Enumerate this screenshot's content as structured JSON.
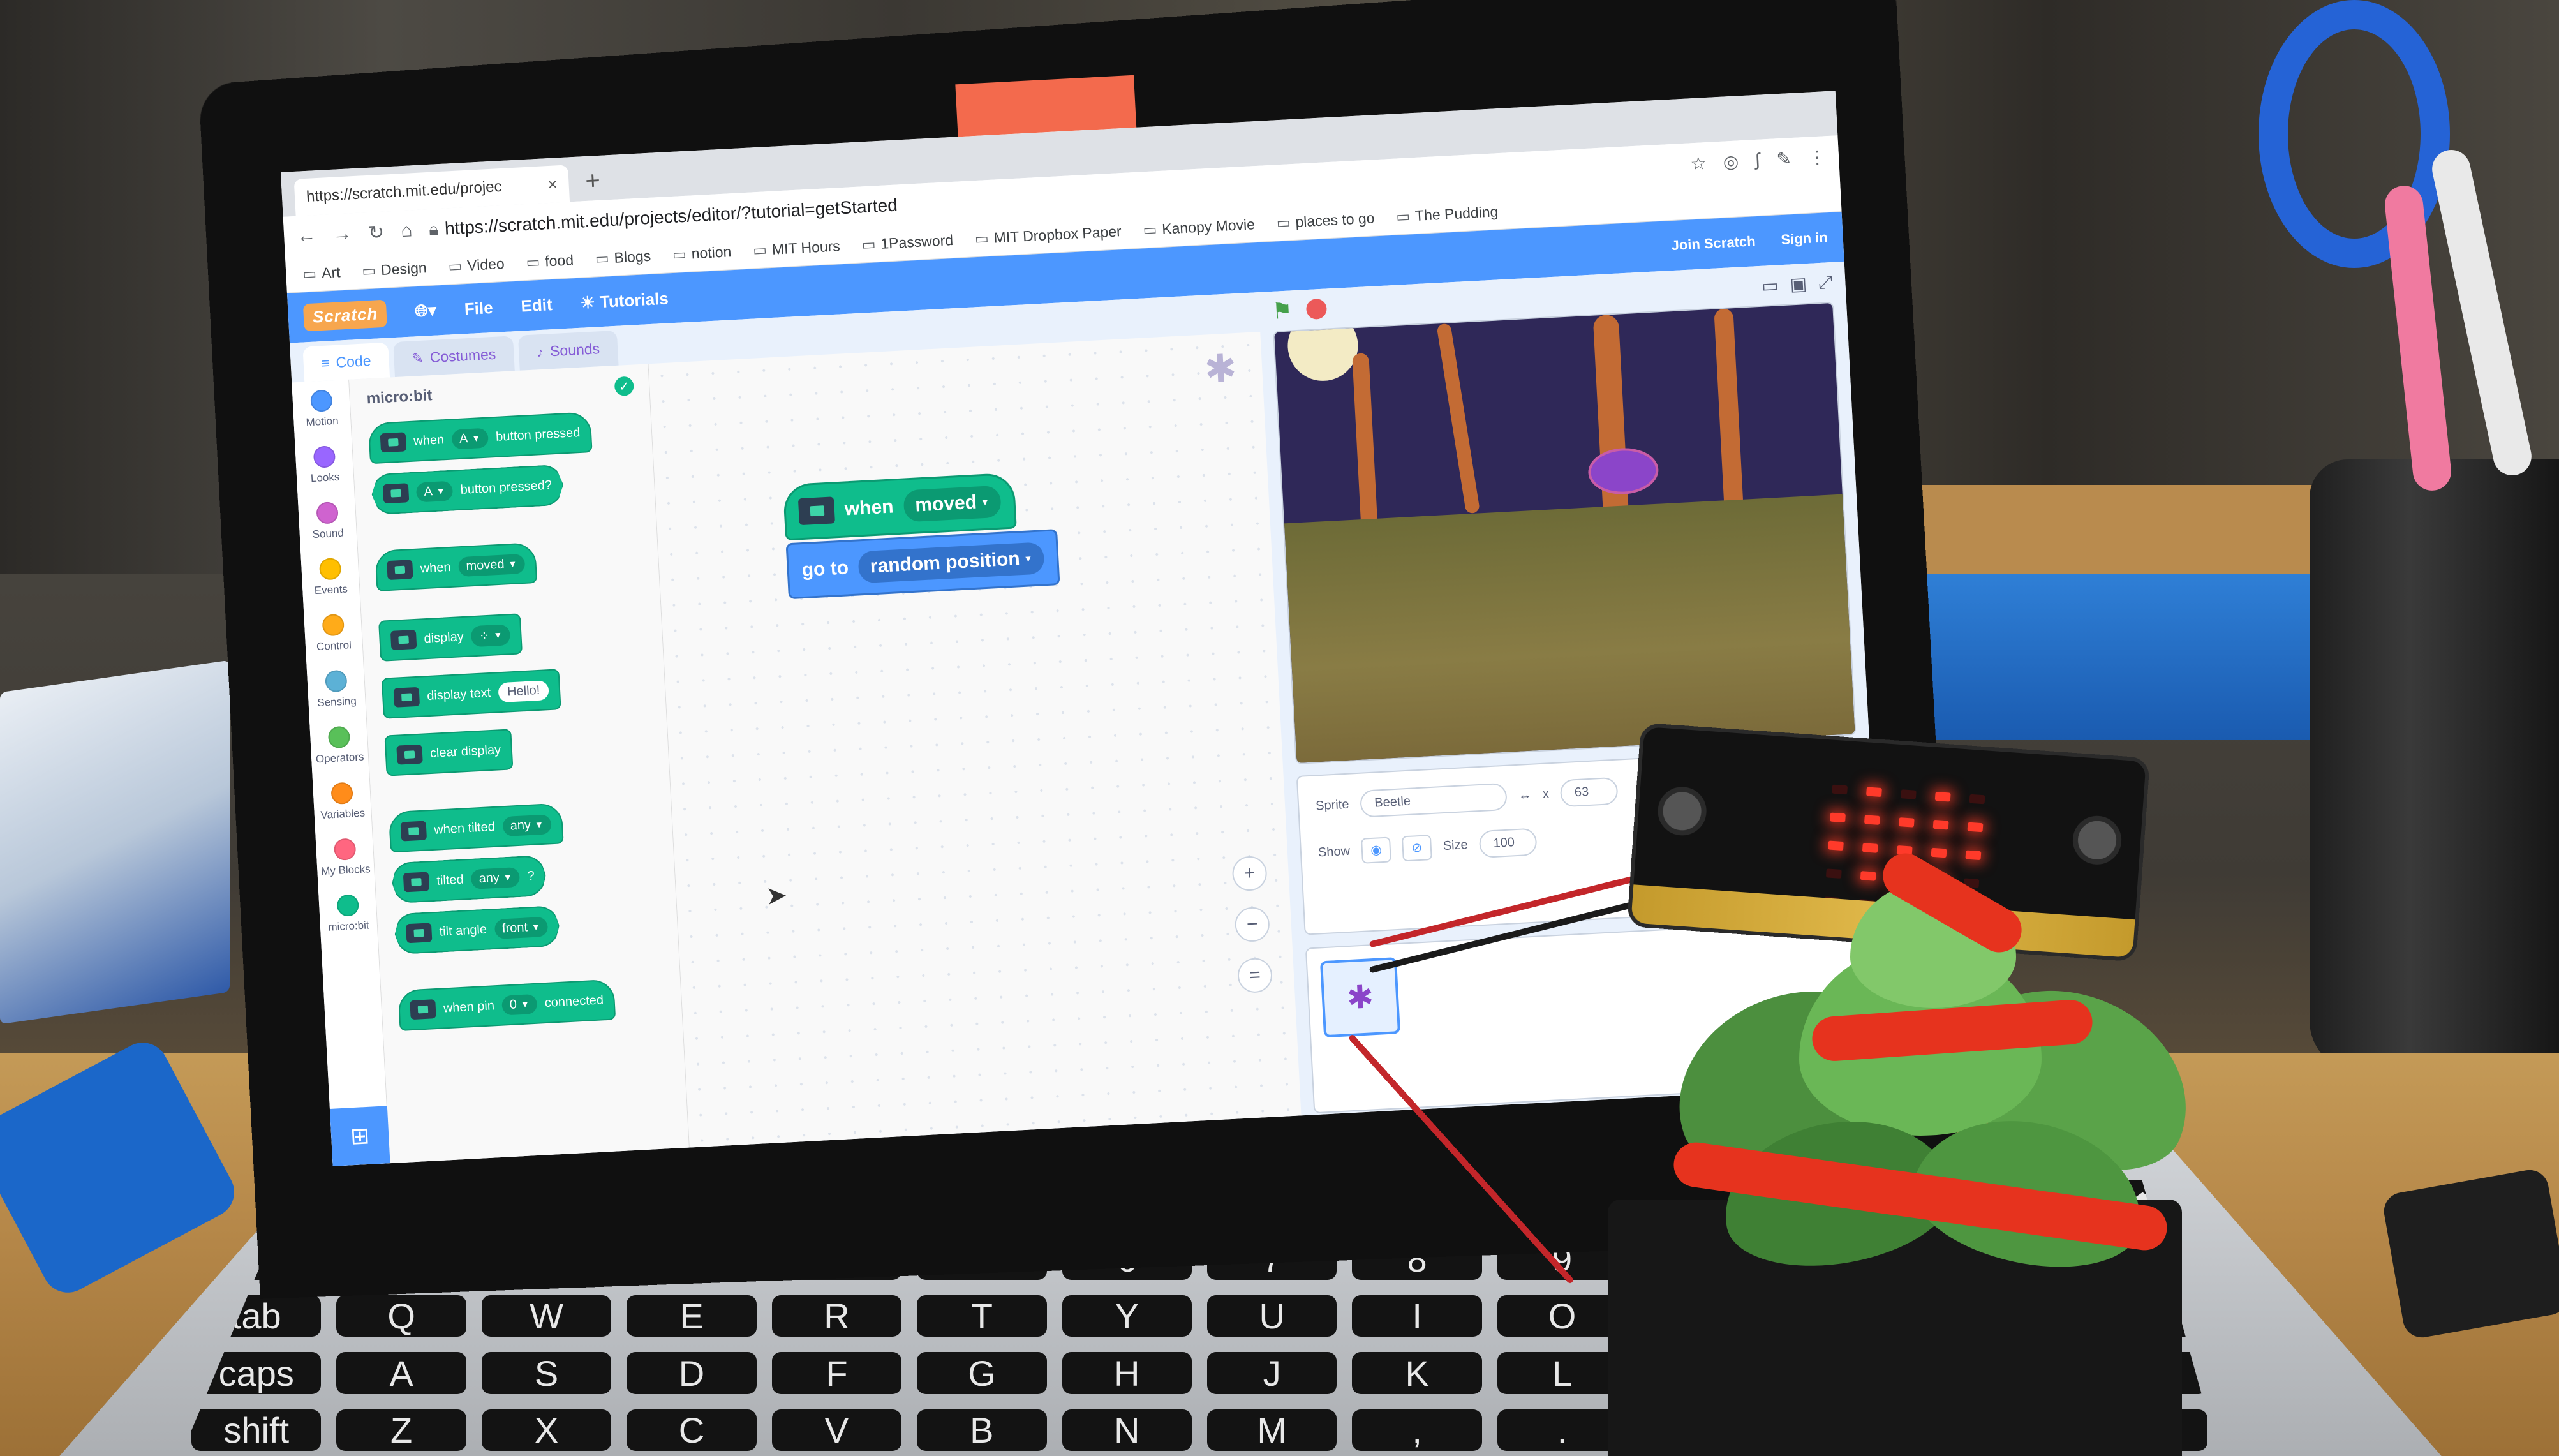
{
  "browser": {
    "tab_title": "https://scratch.mit.edu/projec",
    "tab_close": "×",
    "new_tab": "+",
    "url": "https://scratch.mit.edu/projects/editor/?tutorial=getStarted",
    "bookmarks": [
      "Art",
      "Design",
      "Video",
      "food",
      "Blogs",
      "notion",
      "MIT Hours",
      "1Password",
      "MIT Dropbox Paper",
      "Kanopy Movie",
      "places to go",
      "The Pudding"
    ]
  },
  "scratch_menu": {
    "logo": "Scratch",
    "file": "File",
    "edit": "Edit",
    "tutorials": "Tutorials",
    "join": "Join Scratch",
    "sign_in": "Sign in"
  },
  "editor_tabs": [
    "Code",
    "Costumes",
    "Sounds"
  ],
  "categories": [
    {
      "label": "Motion",
      "color": "#4c97ff"
    },
    {
      "label": "Looks",
      "color": "#9966ff"
    },
    {
      "label": "Sound",
      "color": "#cf63cf"
    },
    {
      "label": "Events",
      "color": "#ffbf00"
    },
    {
      "label": "Control",
      "color": "#ffab19"
    },
    {
      "label": "Sensing",
      "color": "#5cb1d6"
    },
    {
      "label": "Operators",
      "color": "#59c059"
    },
    {
      "label": "Variables",
      "color": "#ff8c1a"
    },
    {
      "label": "My Blocks",
      "color": "#ff6680"
    },
    {
      "label": "micro:bit",
      "color": "#0fbd8c"
    }
  ],
  "palette": {
    "title": "micro:bit",
    "blocks": {
      "when_button": {
        "when": "when",
        "btn": "A",
        "tail": "button pressed"
      },
      "button_pressed": {
        "btn": "A",
        "tail": "button pressed?"
      },
      "when_moved": {
        "when": "when",
        "opt": "moved"
      },
      "display": {
        "label": "display"
      },
      "display_text": {
        "label": "display text",
        "value": "Hello!"
      },
      "clear_display": {
        "label": "clear display"
      },
      "when_tilted": {
        "label": "when tilted",
        "opt": "any"
      },
      "tilted": {
        "label": "tilted",
        "opt": "any",
        "tail": "?"
      },
      "tilt_angle": {
        "label": "tilt angle",
        "opt": "front"
      },
      "when_pin": {
        "label": "when pin",
        "opt": "0",
        "tail": "connected"
      }
    }
  },
  "workspace": {
    "hat": {
      "when": "when",
      "opt": "moved"
    },
    "motion": {
      "label": "go to",
      "opt": "random position"
    },
    "zoom_in": "+",
    "zoom_out": "−",
    "zoom_reset": "="
  },
  "sprite_info": {
    "sprite_label": "Sprite",
    "sprite_name": "Beetle",
    "x_label": "x",
    "x_value": "63",
    "show_label": "Show",
    "size_label": "Size",
    "size_value": "100"
  },
  "microbit_leds": [
    0,
    1,
    0,
    1,
    0,
    1,
    1,
    1,
    1,
    1,
    1,
    1,
    1,
    1,
    1,
    0,
    1,
    1,
    1,
    0,
    0,
    0,
    1,
    0,
    0
  ]
}
